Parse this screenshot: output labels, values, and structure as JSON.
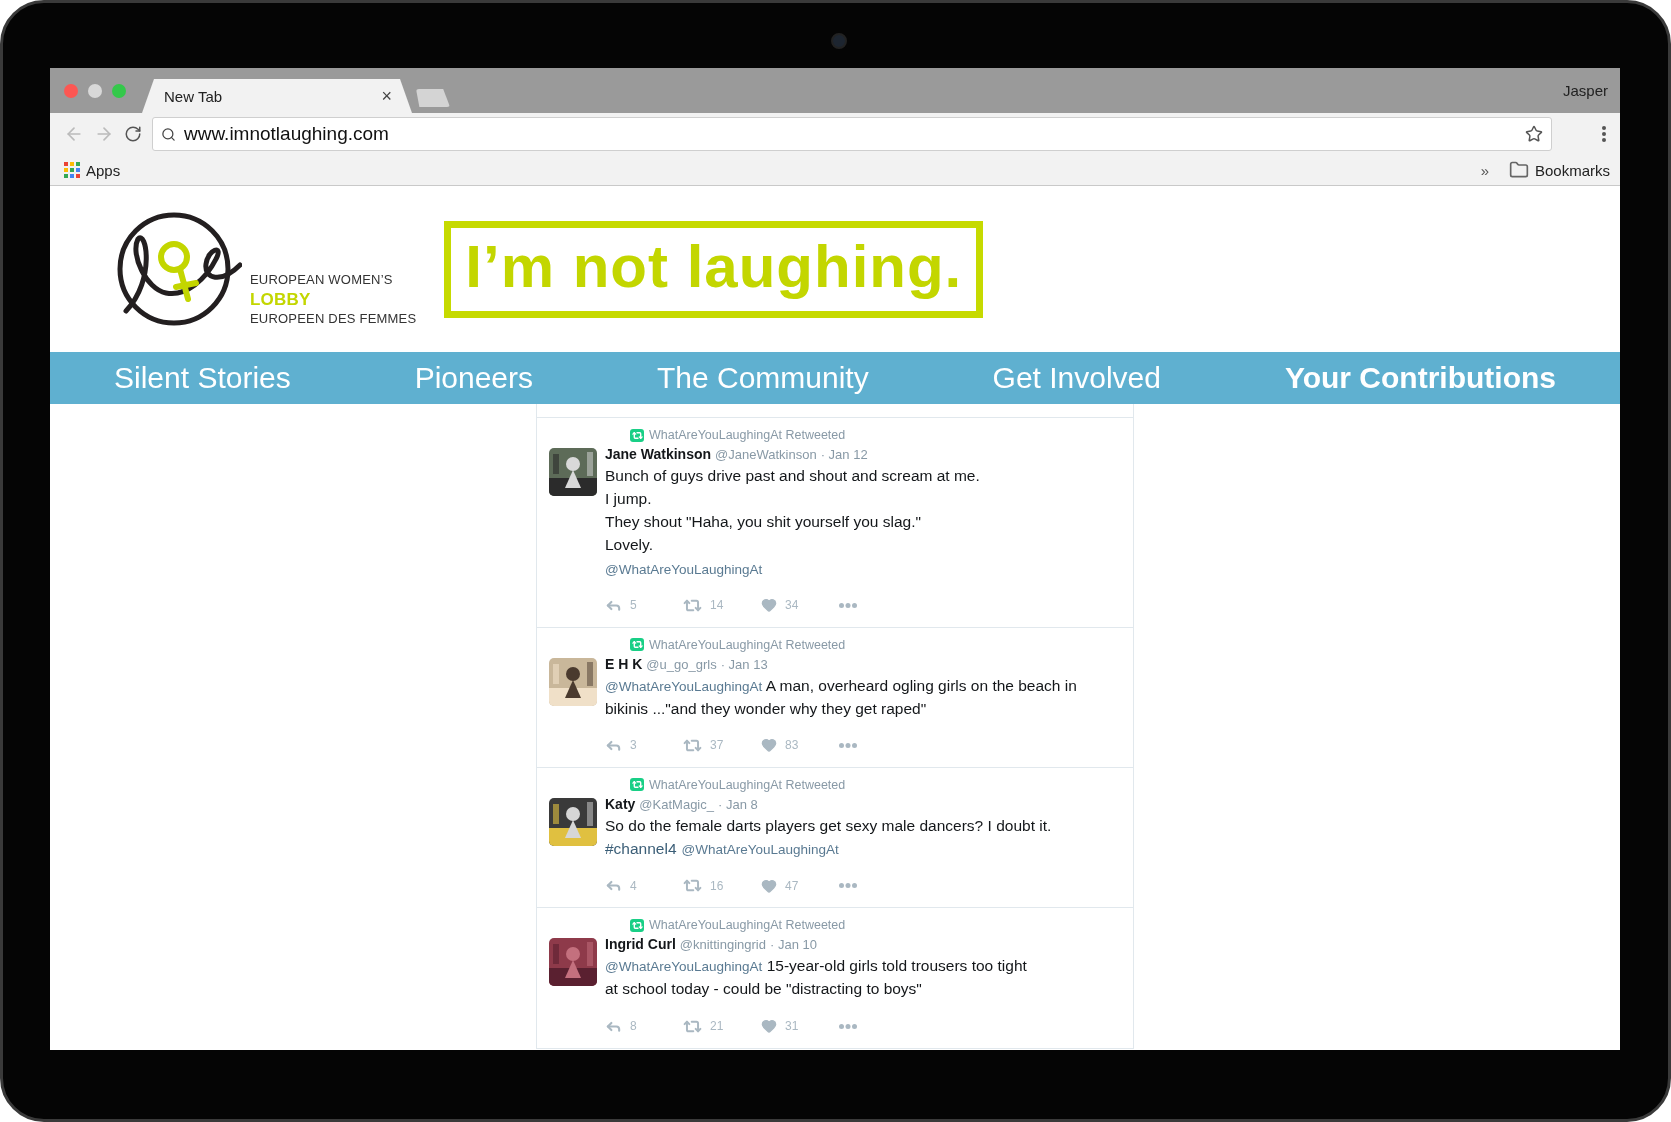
{
  "browser": {
    "tabs": [
      {
        "title": "New Tab",
        "close": "×",
        "selected": true
      }
    ],
    "profile": "Jasper",
    "address": "www.imnotlaughing.com",
    "bookmarks_bar": {
      "apps": "Apps",
      "overflow": "»",
      "folder": "Bookmarks"
    }
  },
  "header": {
    "org_lines": [
      {
        "text": "EUROPEAN WOMEN’S",
        "highlight": false
      },
      {
        "text": "LOBBY",
        "highlight": true
      },
      {
        "text": "EUROPEEN DES FEMMES",
        "highlight": false
      }
    ],
    "banner": "I’m not laughing."
  },
  "nav": [
    {
      "label": "Silent Stories",
      "selected": false
    },
    {
      "label": "Pioneers",
      "selected": false
    },
    {
      "label": "The Community",
      "selected": false
    },
    {
      "label": "Get Involved",
      "selected": false
    },
    {
      "label": "Your Contributions",
      "selected": true
    }
  ],
  "tweets": [
    {
      "retweeted_by": "WhatAreYouLaughingAt Retweeted",
      "name": "Jane Watkinson",
      "handle": "@JaneWatkinson",
      "date": "· Jan 12",
      "lines": [
        [
          {
            "kind": "text",
            "text": "Bunch of guys drive past and shout and scream at me."
          }
        ],
        [
          {
            "kind": "text",
            "text": "I jump."
          }
        ],
        [
          {
            "kind": "text",
            "text": "They shout \"Haha, you shit yourself you slag.\""
          }
        ],
        [
          {
            "kind": "text",
            "text": "Lovely."
          }
        ],
        [
          {
            "kind": "mention",
            "text": "@WhatAreYouLaughingAt"
          }
        ]
      ],
      "replies": "5",
      "retweets": "14",
      "likes": "34"
    },
    {
      "retweeted_by": "WhatAreYouLaughingAt Retweeted",
      "name": "E H K",
      "handle": "@u_go_grls",
      "date": "· Jan 13",
      "lines": [
        [
          {
            "kind": "mention",
            "text": "@WhatAreYouLaughingAt"
          },
          {
            "kind": "text",
            "text": " A man, overheard ogling girls on the beach in"
          }
        ],
        [
          {
            "kind": "text",
            "text": "bikinis ...\"and they wonder why they get raped\""
          }
        ]
      ],
      "replies": "3",
      "retweets": "37",
      "likes": "83"
    },
    {
      "retweeted_by": "WhatAreYouLaughingAt Retweeted",
      "name": "Katy",
      "handle": "@KatMagic_",
      "date": "· Jan 8",
      "lines": [
        [
          {
            "kind": "text",
            "text": "So do the female darts players get sexy male dancers? I doubt it."
          }
        ],
        [
          {
            "kind": "hashtag",
            "text": "#channel4"
          },
          {
            "kind": "mention",
            "text": "@WhatAreYouLaughingAt"
          }
        ]
      ],
      "replies": "4",
      "retweets": "16",
      "likes": "47"
    },
    {
      "retweeted_by": "WhatAreYouLaughingAt Retweeted",
      "name": "Ingrid Curl",
      "handle": "@knittingingrid",
      "date": "· Jan 10",
      "lines": [
        [
          {
            "kind": "mention",
            "text": "@WhatAreYouLaughingAt"
          },
          {
            "kind": "text",
            "text": " 15-year-old girls told trousers too tight"
          }
        ],
        [
          {
            "kind": "text",
            "text": "at school today - could be \"distracting to boys\""
          }
        ]
      ],
      "replies": "8",
      "retweets": "21",
      "likes": "31"
    }
  ]
}
